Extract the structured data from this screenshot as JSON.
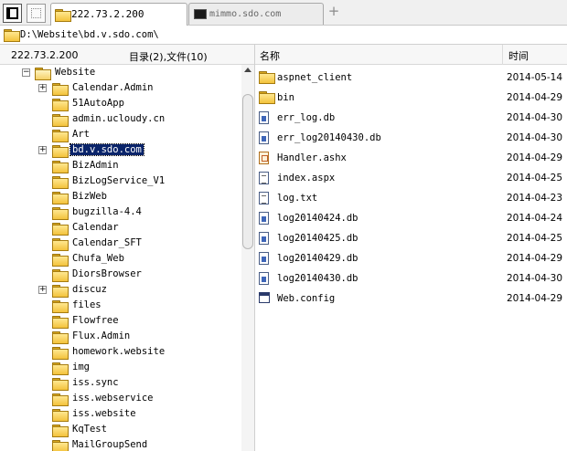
{
  "tabs": [
    {
      "label": "222.73.2.200",
      "active": true,
      "icon": "folder-icon"
    },
    {
      "label": "mimmo.sdo.com",
      "active": false,
      "icon": "terminal-icon"
    }
  ],
  "address": {
    "path": "D:\\Website\\bd.v.sdo.com\\"
  },
  "left_header": {
    "host": "222.73.2.200",
    "count": "目录(2),文件(10)"
  },
  "right_header": {
    "name": "名称",
    "time": "时间"
  },
  "tree": {
    "root": "Website",
    "items": [
      {
        "label": "Calendar.Admin",
        "expandable": true
      },
      {
        "label": "51AutoApp",
        "expandable": false
      },
      {
        "label": "admin.ucloudy.cn",
        "expandable": false
      },
      {
        "label": "Art",
        "expandable": false
      },
      {
        "label": "bd.v.sdo.com",
        "expandable": true,
        "selected": true
      },
      {
        "label": "BizAdmin",
        "expandable": false
      },
      {
        "label": "BizLogService_V1",
        "expandable": false
      },
      {
        "label": "BizWeb",
        "expandable": false
      },
      {
        "label": "bugzilla-4.4",
        "expandable": false
      },
      {
        "label": "Calendar",
        "expandable": false
      },
      {
        "label": "Calendar_SFT",
        "expandable": false
      },
      {
        "label": "Chufa_Web",
        "expandable": false
      },
      {
        "label": "DiorsBrowser",
        "expandable": false
      },
      {
        "label": "discuz",
        "expandable": true
      },
      {
        "label": "files",
        "expandable": false
      },
      {
        "label": "Flowfree",
        "expandable": false
      },
      {
        "label": "Flux.Admin",
        "expandable": false
      },
      {
        "label": "homework.website",
        "expandable": false
      },
      {
        "label": "img",
        "expandable": false
      },
      {
        "label": "iss.sync",
        "expandable": false
      },
      {
        "label": "iss.webservice",
        "expandable": false
      },
      {
        "label": "iss.website",
        "expandable": false
      },
      {
        "label": "KqTest",
        "expandable": false
      },
      {
        "label": "MailGroupSend",
        "expandable": false
      }
    ]
  },
  "files": [
    {
      "name": "aspnet_client",
      "date": "2014-05-14",
      "icon": "folder-icon"
    },
    {
      "name": "bin",
      "date": "2014-04-29",
      "icon": "folder-icon"
    },
    {
      "name": "err_log.db",
      "date": "2014-04-30",
      "icon": "db-file-icon"
    },
    {
      "name": "err_log20140430.db",
      "date": "2014-04-30",
      "icon": "db-file-icon"
    },
    {
      "name": "Handler.ashx",
      "date": "2014-04-29",
      "icon": "ashx-file-icon"
    },
    {
      "name": "index.aspx",
      "date": "2014-04-25",
      "icon": "aspx-file-icon"
    },
    {
      "name": "log.txt",
      "date": "2014-04-23",
      "icon": "text-file-icon"
    },
    {
      "name": "log20140424.db",
      "date": "2014-04-24",
      "icon": "db-file-icon"
    },
    {
      "name": "log20140425.db",
      "date": "2014-04-25",
      "icon": "db-file-icon"
    },
    {
      "name": "log20140429.db",
      "date": "2014-04-29",
      "icon": "db-file-icon"
    },
    {
      "name": "log20140430.db",
      "date": "2014-04-30",
      "icon": "db-file-icon"
    },
    {
      "name": "Web.config",
      "date": "2014-04-29",
      "icon": "config-file-icon"
    }
  ],
  "colors": {
    "selection": "#0a246a",
    "folder": "#f3c23c"
  }
}
